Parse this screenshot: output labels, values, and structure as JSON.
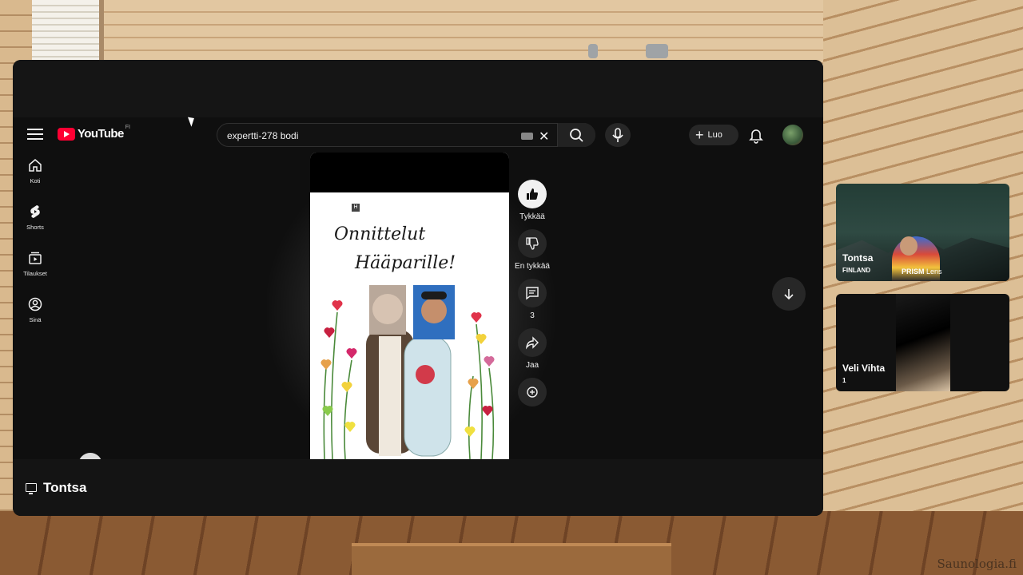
{
  "share": {
    "presenter": "Tontsa"
  },
  "youtube": {
    "logo_text": "YouTube",
    "logo_country": "FI",
    "search_value": "expertti-278 bodi",
    "create_label": "Luo",
    "guide": [
      {
        "label": "Koti",
        "icon": "home-icon"
      },
      {
        "label": "Shorts",
        "icon": "shorts-icon"
      },
      {
        "label": "Tilaukset",
        "icon": "subscriptions-icon"
      },
      {
        "label": "Sinä",
        "icon": "you-icon"
      }
    ],
    "short": {
      "card_badge": "H",
      "card_title_line1": "Onnittelut",
      "card_title_line2": "Hääparille!"
    },
    "actions": {
      "like_label": "Tykkää",
      "dislike_label": "En tykkää",
      "comments_count": "3",
      "share_label": "Jaa"
    }
  },
  "participants": [
    {
      "name": "Tontsa",
      "sub": "FINLAND",
      "lens_prefix": "PRISM",
      "lens_suffix": "Lens"
    },
    {
      "name": "Veli Vihta",
      "sub": "1"
    }
  ],
  "credit": "Saunologia.fi"
}
